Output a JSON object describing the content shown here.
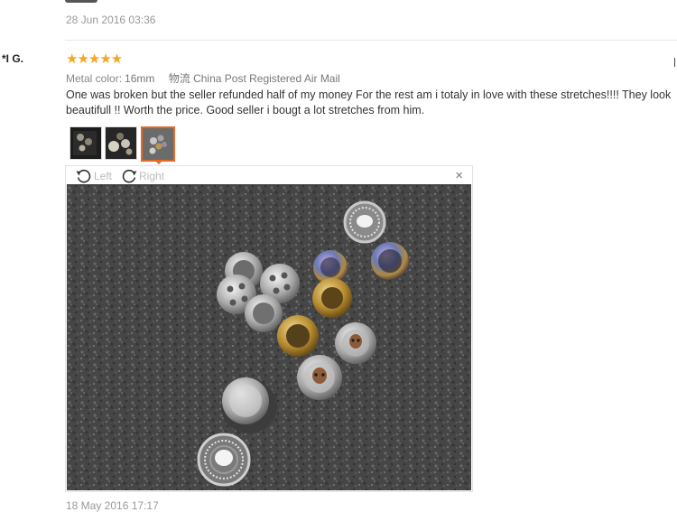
{
  "previous_review": {
    "date": "28 Jun 2016 03:36"
  },
  "review": {
    "user": "*I G.",
    "stars": "★★★★★",
    "metal_color_label": "Metal color:",
    "metal_color_value": "16mm",
    "shipping_label": "物流",
    "shipping_value": "China Post Registered Air Mail",
    "text": "One was broken but the seller refunded half of my money For the rest am i totaly in love with these stretches!!!! They look beautifull !! Worth the price. Good seller i bougt a lot stretches from him.",
    "photo_count": 3,
    "selected_photo": 3,
    "viewer": {
      "rotate_left_label": "Left",
      "rotate_right_label": "Right",
      "close_symbol": "×"
    },
    "date": "18 May 2016 17:17"
  },
  "colors": {
    "stars": "#f5a623",
    "selected_border": "#e46a2a",
    "date": "#999999"
  },
  "icons": [
    "rotate-left-icon",
    "rotate-right-icon",
    "close-icon",
    "star-icon"
  ]
}
